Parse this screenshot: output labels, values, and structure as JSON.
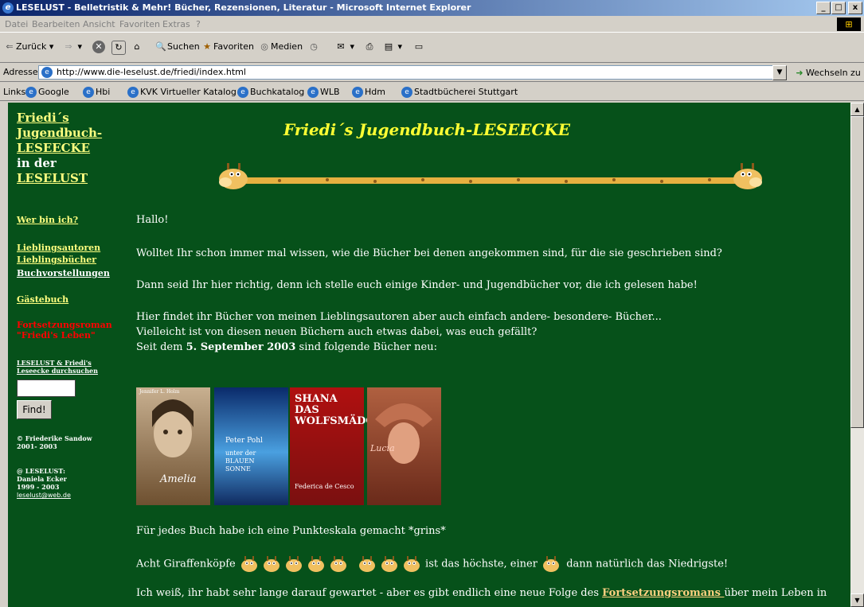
{
  "window": {
    "title": "LESELUST - Belletristik & Mehr! Bücher, Rezensionen, Literatur - Microsoft Internet Explorer",
    "min": "_",
    "max": "□",
    "close": "x"
  },
  "menu": [
    "Datei",
    "Bearbeiten",
    "Ansicht",
    "Favoriten",
    "Extras",
    "?"
  ],
  "toolbar": {
    "back": "Zurück",
    "search": "Suchen",
    "favorites": "Favoriten",
    "media": "Medien"
  },
  "address": {
    "label": "Adresse",
    "url": "http://www.die-leselust.de/friedi/index.html",
    "go": "Wechseln zu"
  },
  "links": {
    "label": "Links",
    "items": [
      "Google",
      "Hbi",
      "KVK Virtueller Katalog",
      "Buchkatalog",
      "WLB",
      "Hdm",
      "Stadtbücherei Stuttgart"
    ]
  },
  "sidebar": {
    "head_l1": "Friedi´s",
    "head_l2": "Jugendbuch-",
    "head_l3": "LESEECKE",
    "head_l4": "in der",
    "head_l5": "LESELUST",
    "wer": "Wer bin ich?",
    "lieblings": "Lieblingsautoren",
    "lieblingsb": "Lieblingsbücher",
    "buchvor": "Buchvorstellungen",
    "gaeste": "Gästebuch",
    "fort1": "Fortsetzungsroman",
    "fort2": "\"Friedi's Leben\"",
    "search_l1": "LESELUST & Friedi's",
    "search_l2": "Leseecke durchsuchen",
    "find": "Find!",
    "c1": "© Friederike Sandow",
    "c2": "2001- 2003",
    "c3": "@ LESELUST:",
    "c4": "Daniela Ecker",
    "c5": "1999 - 2003",
    "c6": "leselust@web.de"
  },
  "main": {
    "title": "Friedi´s Jugendbuch-LESEECKE",
    "hallo": "Hallo!",
    "p1": "Wolltet Ihr schon immer mal wissen, wie die Bücher bei denen angekommen sind, für die sie geschrieben sind?",
    "p2": "Dann seid Ihr hier richtig, denn ich stelle euch einige Kinder- und Jugendbücher vor, die ich gelesen habe!",
    "p3a": "Hier findet ihr Bücher von meinen Lieblingsautoren aber auch einfach andere- besondere- Bücher...",
    "p3b": "Vielleicht ist von diesen neuen Büchern auch etwas dabei, was euch gefällt?",
    "p3c_pre": "Seit dem ",
    "p3c_date": "5. September 2003",
    "p3c_post": "  sind folgende Bücher neu:",
    "books": [
      {
        "title": "Amelia",
        "author": "Jennifer L. Holm"
      },
      {
        "title": "unter der BLAUEN SONNE",
        "author": "Peter Pohl"
      },
      {
        "title": "SHANA DAS WOLFSMÄDCHEN",
        "author": "Federica de Cesco"
      },
      {
        "title": "Lucia",
        "author": "Lucia"
      }
    ],
    "p4": "Für jedes Buch habe ich eine Punkteskala gemacht *grins*",
    "p5a": "Acht Giraffenköpfe",
    "p5b": "ist das höchste, einer",
    "p5c": "dann natürlich das Niedrigste!",
    "p6a": "Ich weiß, ihr habt sehr lange darauf gewartet - aber es gibt endlich eine neue Folge des ",
    "p6link": "Fortsetzungsromans ",
    "p6b": "über mein Leben in"
  }
}
